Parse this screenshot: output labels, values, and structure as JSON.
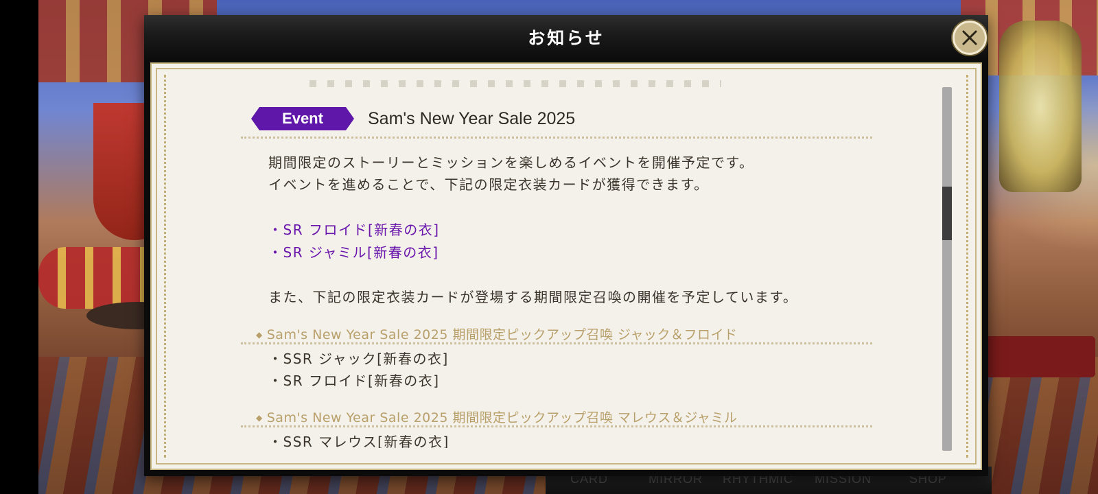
{
  "dialog": {
    "title": "お知らせ",
    "close_icon": "close-x-icon"
  },
  "notice": {
    "category_badge": "Event",
    "title": "Sam's New Year Sale 2025",
    "intro_lines": [
      "期間限定のストーリーとミッションを楽しめるイベントを開催予定です。",
      "イベントを進めることで、下記の限定衣装カードが獲得できます。"
    ],
    "event_cards": [
      "・SR フロイド[新春の衣]",
      "・SR ジャミル[新春の衣]"
    ],
    "summon_intro": "また、下記の限定衣装カードが登場する期間限定召喚の開催を予定しています。",
    "summons": [
      {
        "heading": "Sam's New Year Sale 2025 期間限定ピックアップ召喚 ジャック＆フロイド",
        "cards": [
          "・SSR ジャック[新春の衣]",
          "・SR フロイド[新春の衣]"
        ]
      },
      {
        "heading": "Sam's New Year Sale 2025 期間限定ピックアップ召喚 マレウス＆ジャミル",
        "cards": [
          "・SSR マレウス[新春の衣]"
        ]
      }
    ]
  },
  "bottom_nav": [
    "CARD",
    "MIRROR",
    "RHYTHMIC",
    "MISSION",
    "SHOP"
  ],
  "colors": {
    "badge": "#5e17a8",
    "highlight_text": "#6a16ad",
    "gold": "#c7b584",
    "panel": "#f3f1ea"
  },
  "scroll_position": 0.3
}
